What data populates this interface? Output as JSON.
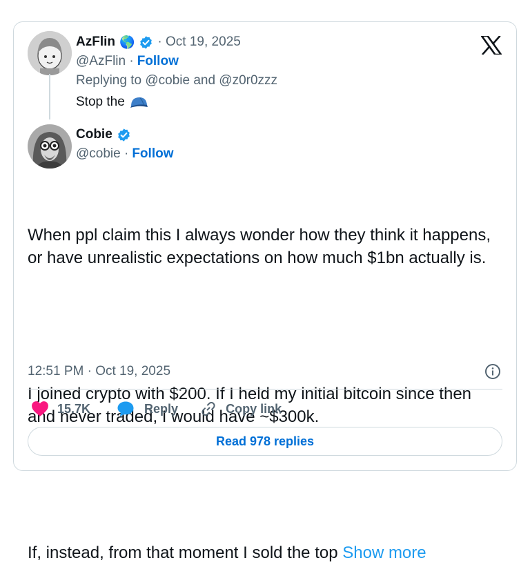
{
  "reply_tweet": {
    "display_name": "AzFlin",
    "globe_emoji": "🌎",
    "date": "· Oct 19, 2025",
    "handle": "@AzFlin ·",
    "follow_label": "Follow",
    "replying_to": "Replying to @cobie and @z0r0zzz",
    "text": "Stop the",
    "cap_emoji": "blue-cap-emoji"
  },
  "main_tweet": {
    "display_name": "Cobie",
    "handle": "@cobie ·",
    "follow_label": "Follow",
    "paragraph_1": "When ppl claim this I always wonder how they think it happens, or have unrealistic expectations on how much $1bn actually is.",
    "paragraph_2": "I joined crypto with $200. If I held my initial bitcoin since then and never traded, I would have ~$300k.",
    "paragraph_3": "If, instead, from that moment I sold the top ",
    "show_more": "Show more",
    "timestamp": "12:51 PM · Oct 19, 2025"
  },
  "actions": {
    "likes": "15.7K",
    "reply_label": "Reply",
    "copy_link_label": "Copy link",
    "read_replies_label": "Read 978 replies"
  },
  "colors": {
    "like_pink": "#f91880",
    "verified_blue": "#1d9bf0",
    "link_blue": "#006fd6",
    "muted_text": "#536471",
    "border": "#cfd9de"
  },
  "icons": [
    "x-logo-icon",
    "verified-badge-icon",
    "globe-emoji",
    "blue-cap-emoji",
    "info-icon",
    "heart-icon",
    "reply-bubble-icon",
    "link-icon"
  ]
}
